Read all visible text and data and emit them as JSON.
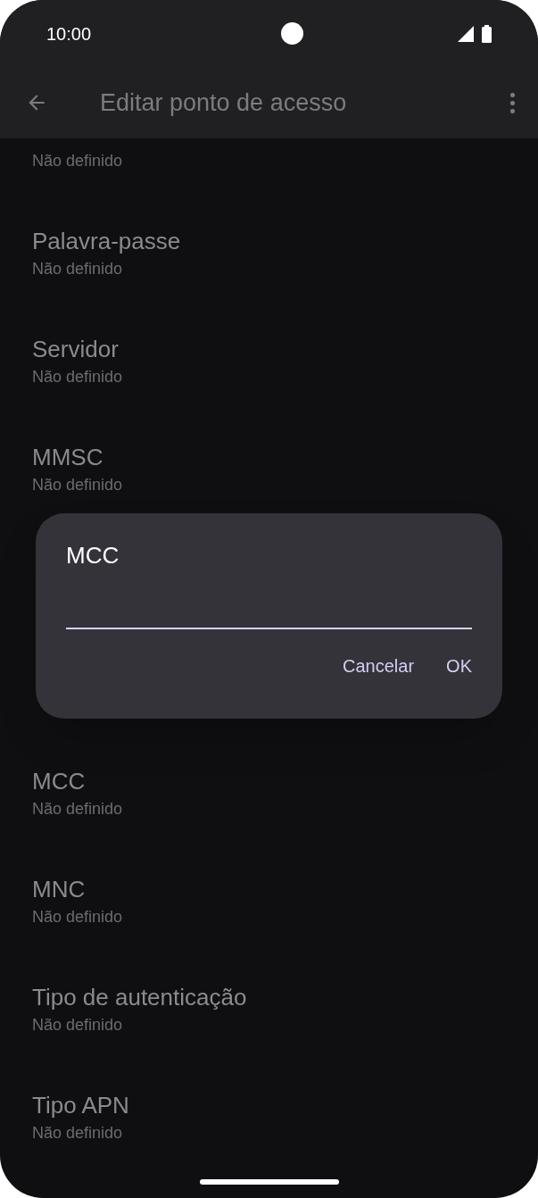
{
  "status_bar": {
    "time": "10:00"
  },
  "app_bar": {
    "title": "Editar ponto de acesso"
  },
  "settings": [
    {
      "value": "Não definido"
    },
    {
      "title": "Palavra-passe",
      "value": "Não definido"
    },
    {
      "title": "Servidor",
      "value": "Não definido"
    },
    {
      "title": "MMSC",
      "value": "Não definido"
    },
    {
      "title": "MCC",
      "value": "Não definido"
    },
    {
      "title": "MNC",
      "value": "Não definido"
    },
    {
      "title": "Tipo de autenticação",
      "value": "Não definido"
    },
    {
      "title": "Tipo APN",
      "value": "Não definido"
    }
  ],
  "dialog": {
    "title": "MCC",
    "buttons": [
      "Cancelar",
      "OK"
    ]
  }
}
